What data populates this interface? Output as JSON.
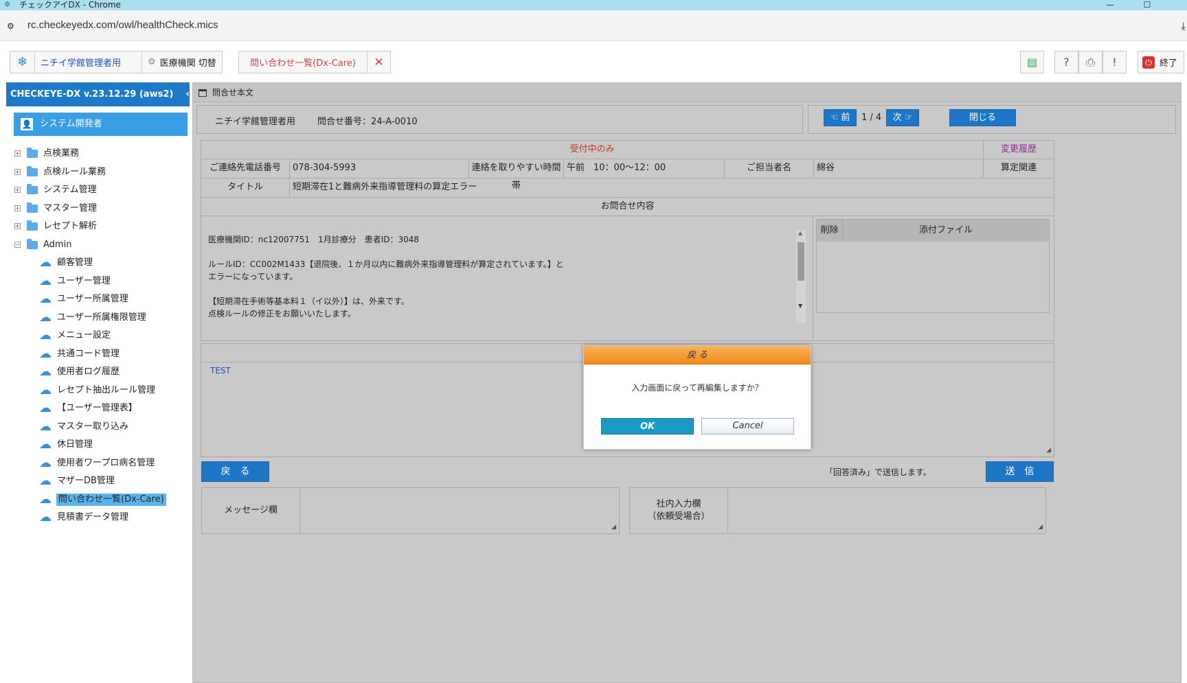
{
  "window": {
    "title": "チェックアイDX - Chrome",
    "minimize": "—",
    "maximize": "☐"
  },
  "browser": {
    "url": "rc.checkeyedx.com/owl/healthCheck.mics"
  },
  "toolbar": {
    "user_link": "ニチイ学館管理者用",
    "switch_label": "医療機関 切替",
    "inquiry_tab": "問い合わせ一覧(Dx-Care)",
    "exit_label": "終了"
  },
  "sidebar": {
    "version": "CHECKEYE-DX v.23.12.29 (aws2)",
    "user": "システム開発者",
    "folders": [
      "点検業務",
      "点検ルール業務",
      "システム管理",
      "マスター管理",
      "レセプト解析",
      "Admin"
    ],
    "admin_items": [
      "顧客管理",
      "ユーザー管理",
      "ユーザー所属管理",
      "ユーザー所属権限管理",
      "メニュー設定",
      "共通コード管理",
      "使用者ログ履歴",
      "レセプト抽出ルール管理",
      "【ユーザー管理表】",
      "マスター取り込み",
      "休日管理",
      "使用者ワープロ病名管理",
      "マザーDB管理",
      "問い合わせ一覧(Dx-Care)",
      "見積書データ管理"
    ]
  },
  "panel": {
    "title": "問合せ本文",
    "company": "ニチイ学館管理者用",
    "inquiry_number": "問合せ番号：24-A-0010",
    "prev": "前",
    "page": "1 / 4",
    "next": "次",
    "close": "閉じる",
    "status": "受付中のみ",
    "history": "変更履歴",
    "phone_label": "ご連絡先電話番号",
    "phone": "078-304-5993",
    "time_label": "連絡を取りやすい時間帯",
    "time": "午前　10：00～12：00",
    "person_label": "ご担当者名",
    "person": "綿谷",
    "category": "算定関連",
    "title_label": "タイトル",
    "title_value": "短期滞在1と難病外来指導管理料の算定エラー",
    "content_label": "お問合せ内容",
    "content_lines": [
      "医療機関ID：nc12007751　1月診療分　患者ID：3048",
      "",
      "ルールID：CC002M1433【退院後、１か月以内に難病外来指導管理料が算定されています。】と",
      "エラーになっています。",
      "",
      "【短期滞在手術等基本料１（イ以外）】は、外来です。",
      "点検ルールの修正をお願いいたします。"
    ],
    "attach_delete": "削除",
    "attach_file": "添付ファイル",
    "reply_text": "TEST",
    "back_button": "戻　る",
    "send_note": "「回答済み」で送信します。",
    "send_button": "送　信",
    "message_label": "メッセージ欄",
    "internal_label_1": "社内入力欄",
    "internal_label_2": "（依頼受場合）"
  },
  "dialog": {
    "title": "戻 る",
    "message": "入力画面に戻って再編集しますか？",
    "ok": "OK",
    "cancel": "Cancel"
  }
}
